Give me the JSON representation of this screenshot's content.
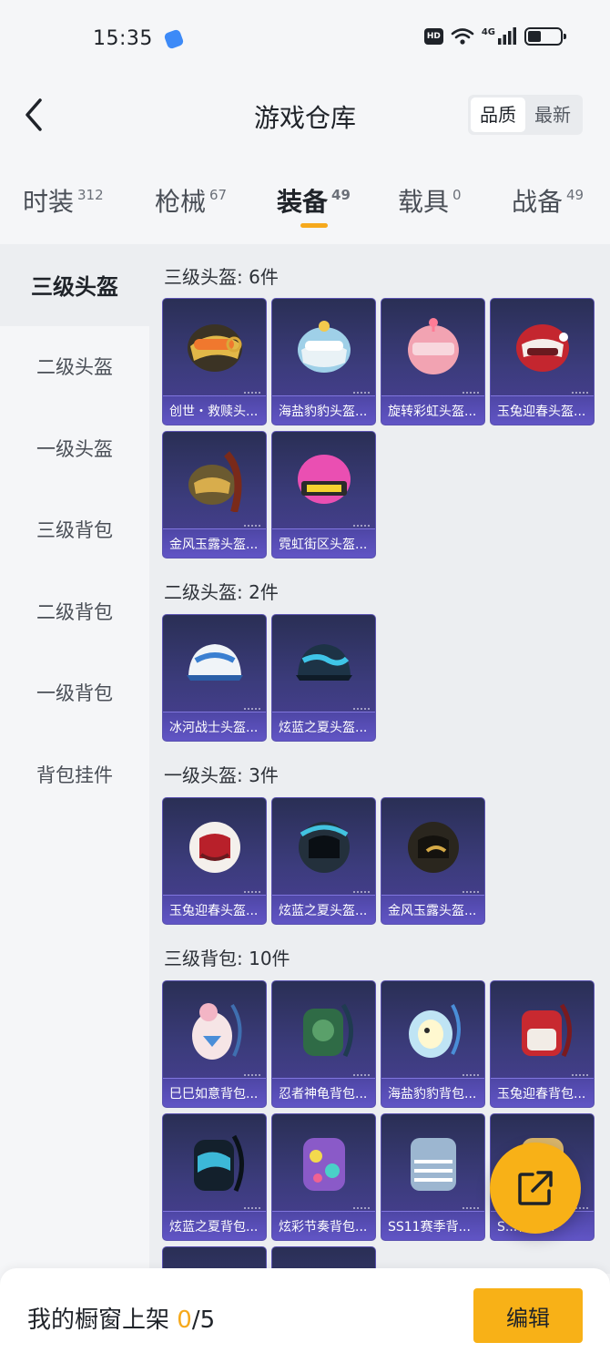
{
  "status_bar": {
    "time": "15:35",
    "network": "4G",
    "hd": "HD"
  },
  "header": {
    "title": "游戏仓库",
    "sort_options": [
      "品质",
      "最新"
    ],
    "active_sort": "品质"
  },
  "tabs": [
    {
      "label": "时装",
      "count": "312"
    },
    {
      "label": "枪械",
      "count": "67"
    },
    {
      "label": "装备",
      "count": "49",
      "active": true
    },
    {
      "label": "载具",
      "count": "0"
    },
    {
      "label": "战备",
      "count": "49"
    }
  ],
  "sidebar": [
    "三级头盔",
    "二级头盔",
    "一级头盔",
    "三级背包",
    "二级背包",
    "一级背包",
    "背包挂件"
  ],
  "sections": [
    {
      "title": "三级头盔: 6件",
      "items": [
        "创世・救赎头...",
        "海盐豹豹头盔...",
        "旋转彩虹头盔...",
        "玉兔迎春头盔...",
        "金风玉露头盔...",
        "霓虹街区头盔..."
      ]
    },
    {
      "title": "二级头盔: 2件",
      "items": [
        "冰河战士头盔...",
        "炫蓝之夏头盔..."
      ]
    },
    {
      "title": "一级头盔: 3件",
      "items": [
        "玉兔迎春头盔...",
        "炫蓝之夏头盔...",
        "金风玉露头盔..."
      ]
    },
    {
      "title": "三级背包: 10件",
      "items": [
        "巳巳如意背包...",
        "忍者神龟背包...",
        "海盐豹豹背包...",
        "玉兔迎春背包...",
        "炫蓝之夏背包...",
        "炫彩节奏背包...",
        "SS11赛季背...",
        "S...背包..."
      ]
    }
  ],
  "bottom": {
    "showcase_label": "我的橱窗上架 ",
    "showcase_count": "0",
    "showcase_total": "/5",
    "edit_label": "编辑"
  },
  "colors": {
    "accent": "#f8b117",
    "card_bg": "#3c3c7d"
  },
  "icons": [
    "back-arrow-icon",
    "wifi-icon",
    "signal-icon",
    "battery-icon",
    "share-icon"
  ]
}
